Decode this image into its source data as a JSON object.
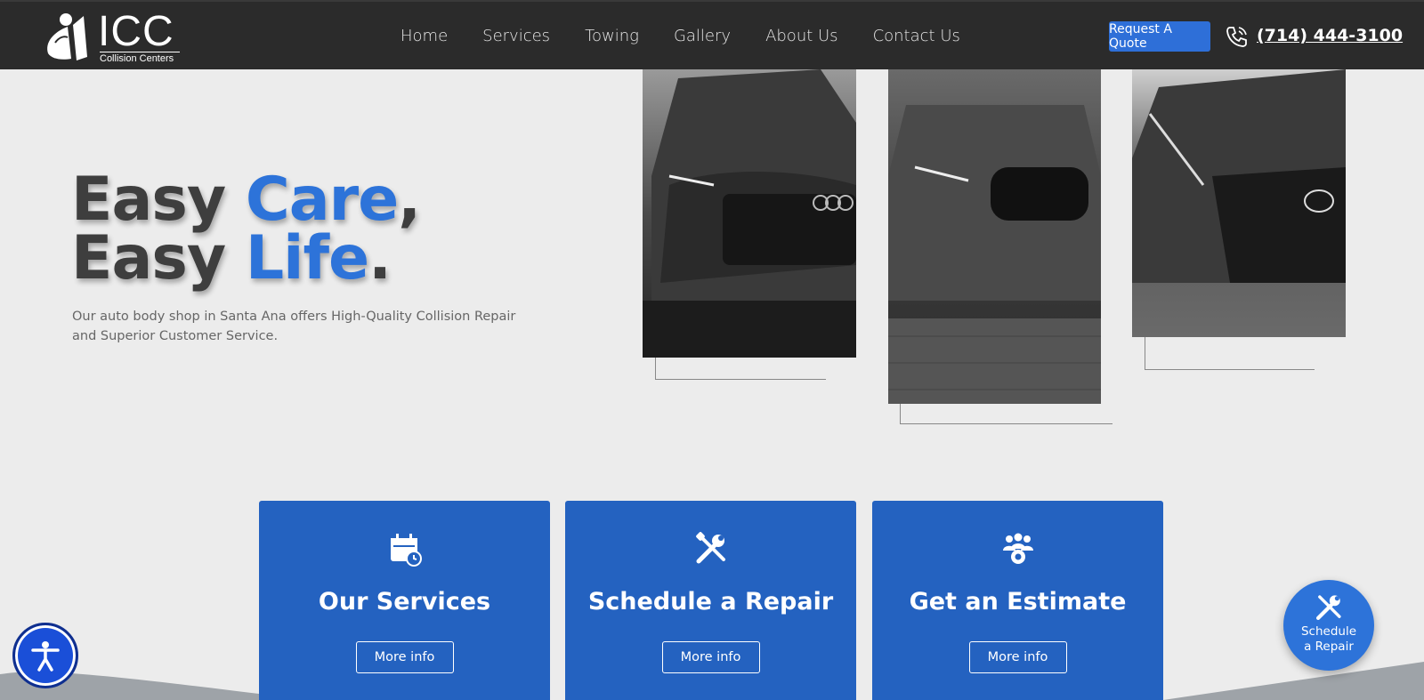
{
  "header": {
    "logo_text": "ICC",
    "logo_sub": "Collision Centers",
    "nav": [
      "Home",
      "Services",
      "Towing",
      "Gallery",
      "About Us",
      "Contact Us"
    ],
    "quote_label": "Request A Quote",
    "phone": "(714) 444-3100"
  },
  "hero": {
    "line1_a": "Easy ",
    "line1_b": "Care",
    "line1_c": ",",
    "line2_a": "Easy ",
    "line2_b": "Life",
    "line2_c": ".",
    "description": "Our auto body shop in Santa Ana offers High-Quality Collision Repair and Superior Customer Service."
  },
  "cards": [
    {
      "title": "Our Services",
      "button": "More info",
      "icon": "calendar-icon"
    },
    {
      "title": "Schedule a Repair",
      "button": "More info",
      "icon": "tools-icon"
    },
    {
      "title": "Get an Estimate",
      "button": "More info",
      "icon": "team-icon"
    }
  ],
  "fab": {
    "line1": "Schedule",
    "line2": "a Repair"
  },
  "colors": {
    "accent": "#2d73d9",
    "card": "#2462c0",
    "header": "#2b2b2b"
  }
}
